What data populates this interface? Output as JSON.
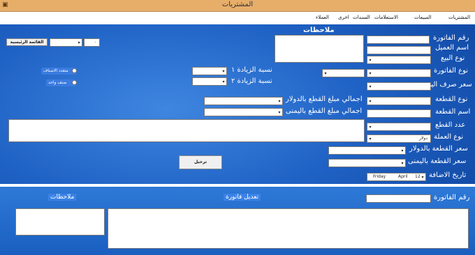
{
  "window": {
    "title": "المشتريات"
  },
  "menu": {
    "items": [
      "المشتريات",
      "المبيعات",
      "الاستعلامات",
      "السندات",
      "اخرى",
      "العملاء"
    ]
  },
  "form": {
    "notes_label": "ملاحظات",
    "invoice_no_label": "رقم الفاتورة",
    "customer_name_label": "اسم العميل",
    "sale_type_label": "نوع البيع",
    "invoice_type_label": "نوع الفاتورة",
    "exchange_rate_label": "سعر صرف اليوم",
    "part_type_label": "نوع القطعة",
    "part_name_label": "اسم القطعة",
    "part_count_label": "عدد القطع",
    "currency_type_label": "نوع العملة",
    "currency_value": "دولار",
    "price_usd_label": "سعر القطعة بالدولار",
    "price_yer_label": "سعر القطعة باليمنى",
    "date_added_label": "تاريخ الاضافة",
    "date": {
      "day_name": "Friday",
      "month": "April",
      "day": "12"
    },
    "increase1_label": "نسبة الزيادة ١",
    "increase2_label": "نسبة الزيادة ٢",
    "total_usd_label": "اجمالي مبلغ القطع بالدولار",
    "total_yer_label": "اجمالي مبلغ القطع باليمنى",
    "main_menu_button": "القائمة الرئيسية",
    "post_button": "ترحيل",
    "radio_multi": "متعدد الاصناف",
    "radio_single": "صنف واحد",
    "small_combo_value": "٠"
  },
  "edit_section": {
    "invoice_no_label": "رقم الفاتورة",
    "edit_invoice_label": "تعديل فاتورة",
    "notes_label": "ملاحظات"
  }
}
